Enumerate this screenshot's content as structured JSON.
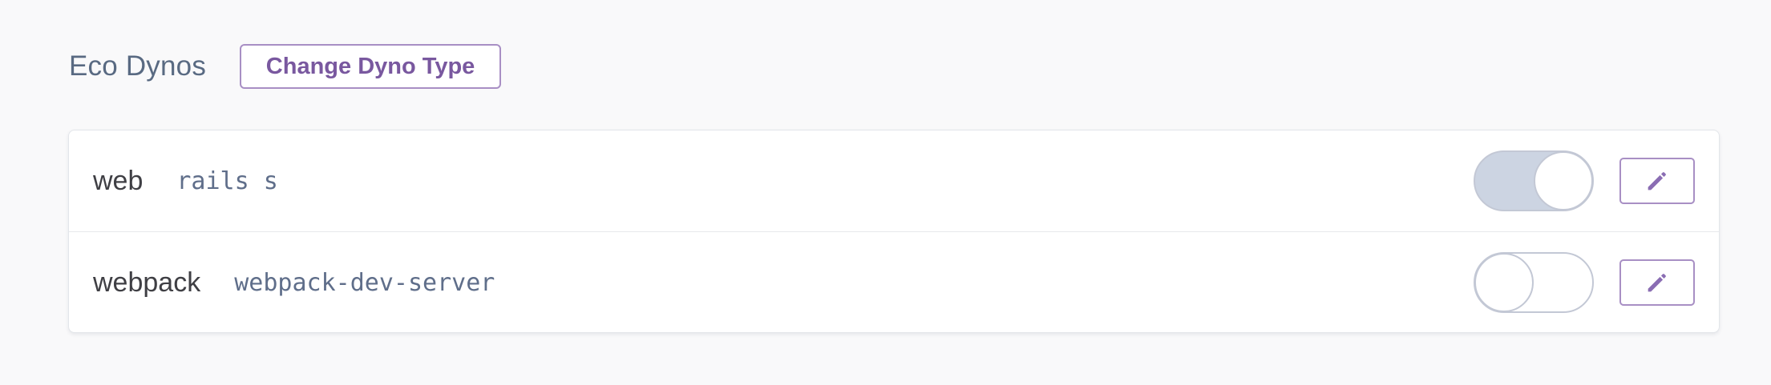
{
  "section": {
    "title": "Eco Dynos",
    "change_button_label": "Change Dyno Type"
  },
  "dynos": [
    {
      "name": "web",
      "command": "rails s",
      "enabled": true,
      "edit_icon": "pencil-icon"
    },
    {
      "name": "webpack",
      "command": "webpack-dev-server",
      "enabled": false,
      "edit_icon": "pencil-icon"
    }
  ],
  "colors": {
    "accent": "#79589f",
    "accent_border": "#a88fc4",
    "title": "#596a82",
    "command": "#5f6e8a",
    "toggle_on_bg": "#ccd4e2",
    "toggle_border": "#c3c8d5"
  }
}
